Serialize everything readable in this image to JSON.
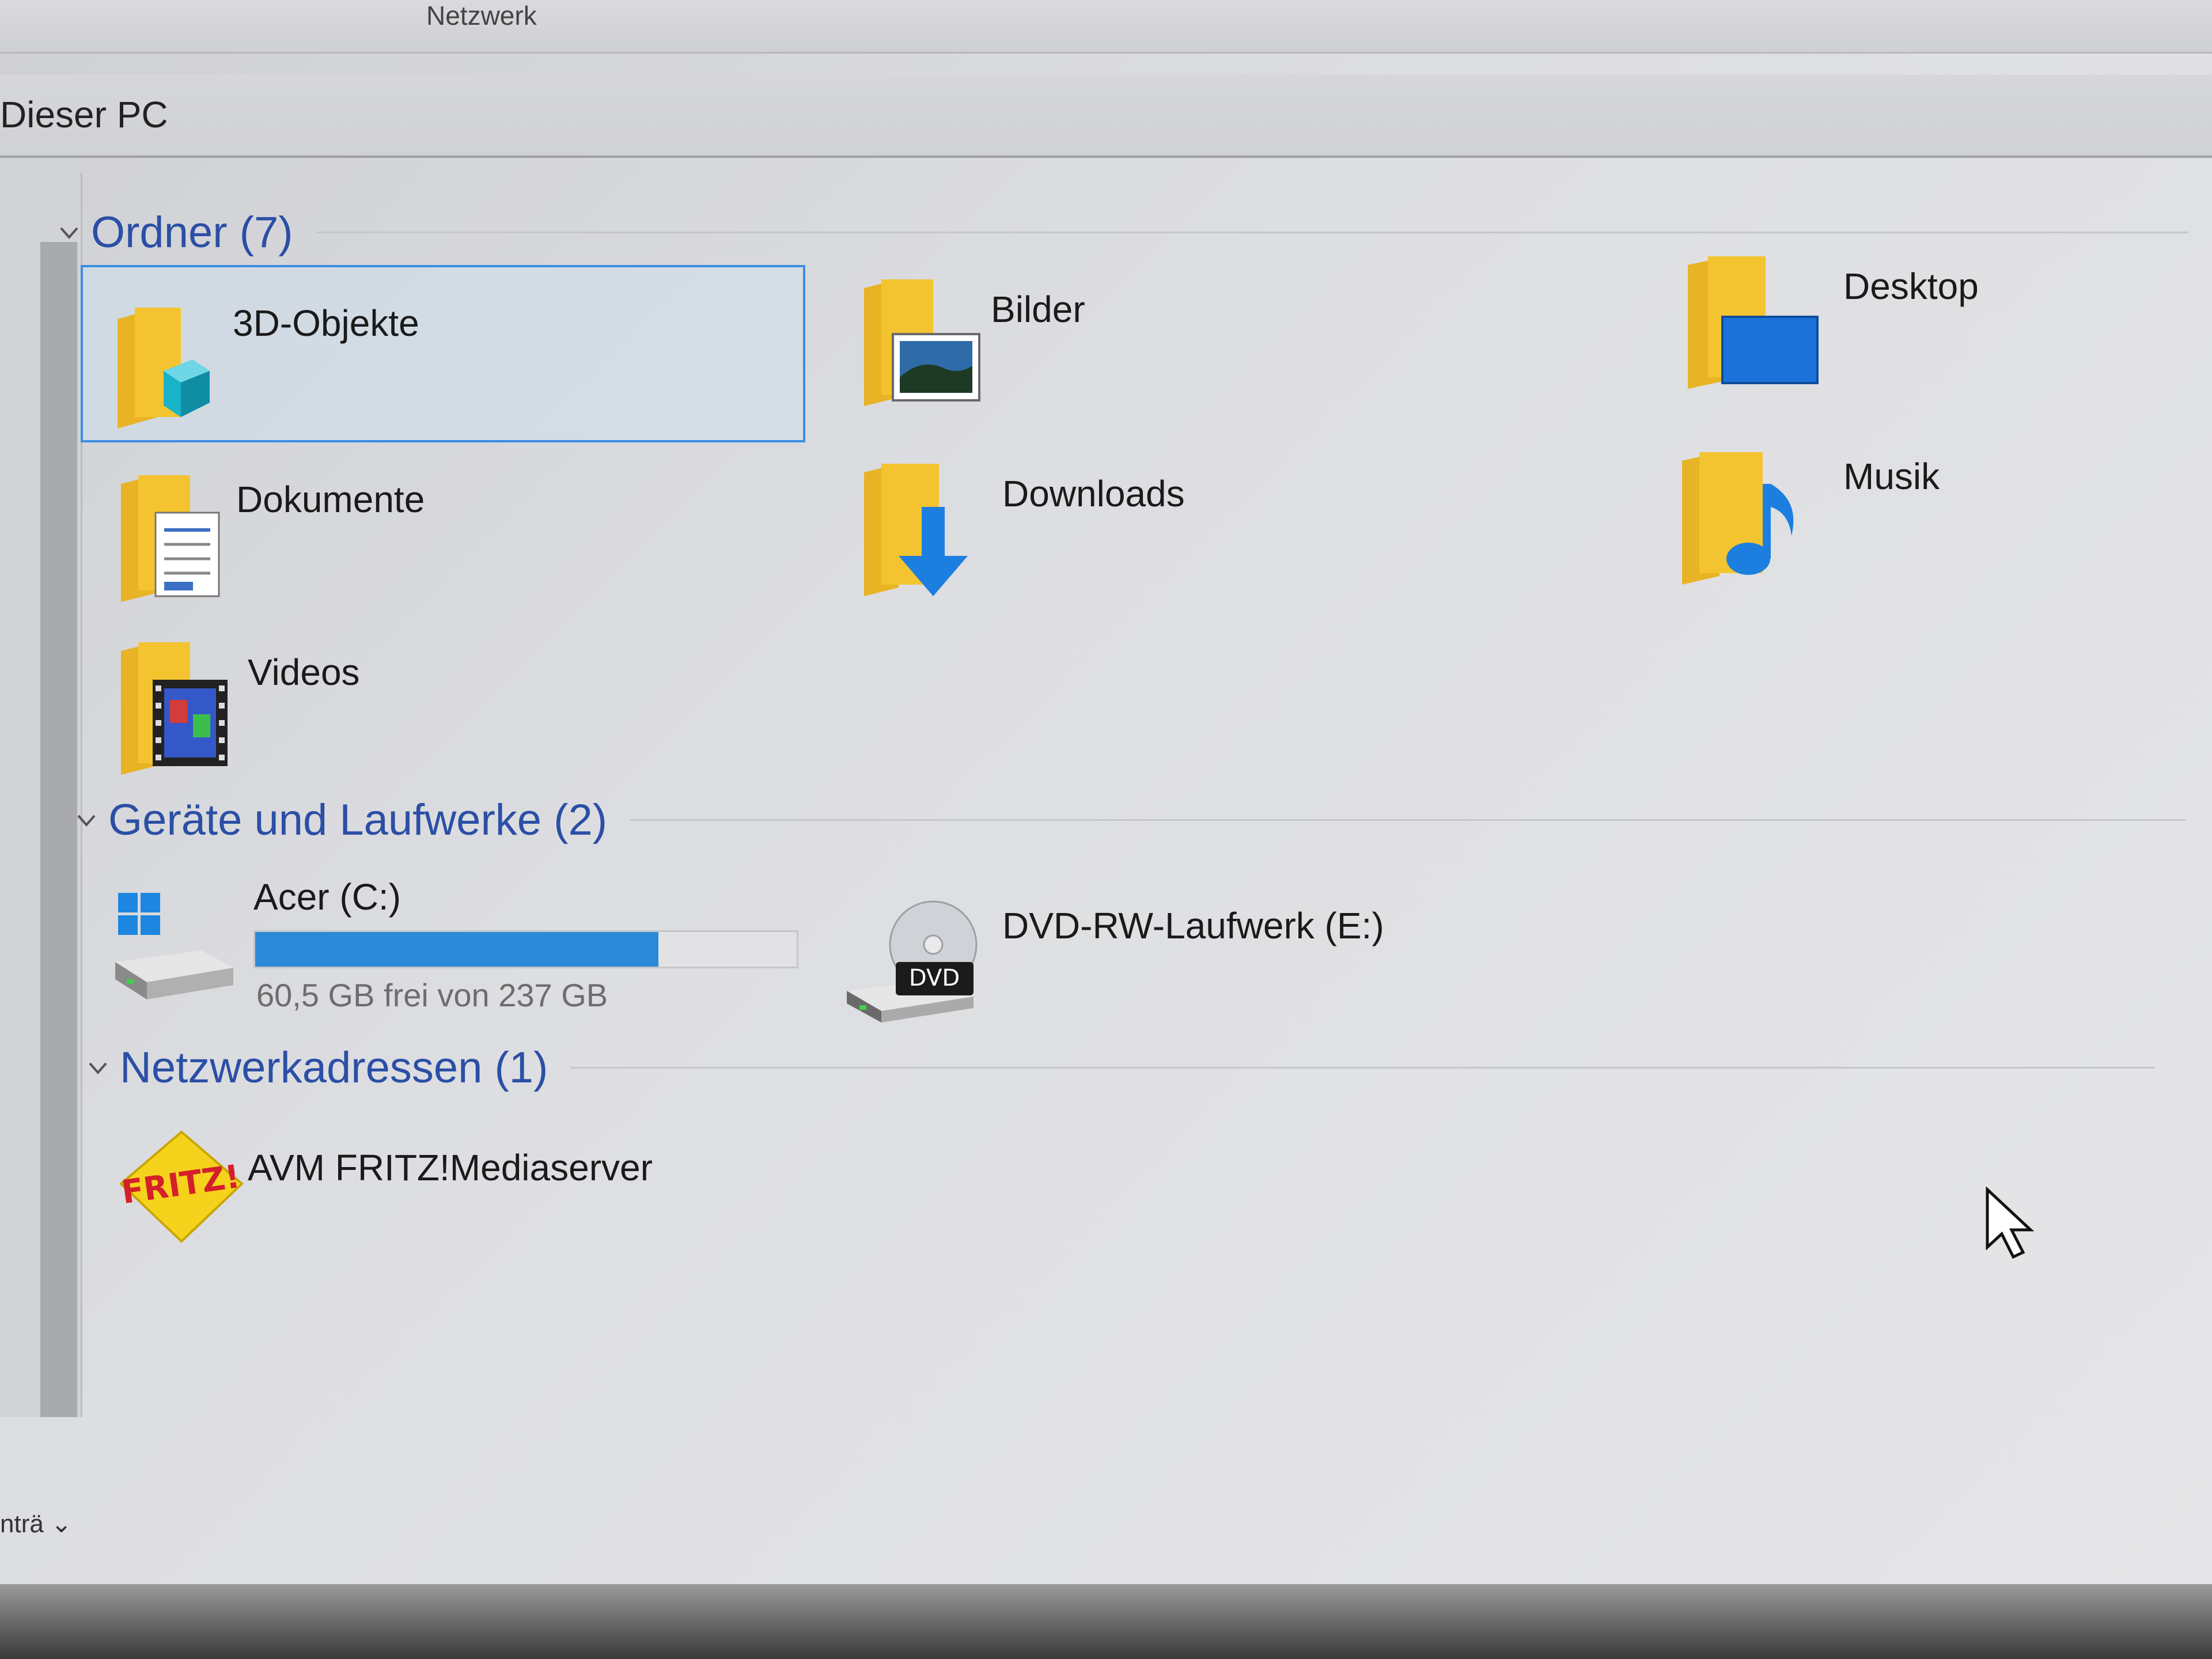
{
  "window": {
    "tab_text": "Netzwerk",
    "address": "Dieser PC",
    "nav_bottom": "nträ"
  },
  "groups": {
    "folders": {
      "title": "Ordner (7)",
      "items": [
        {
          "label": "3D-Objekte",
          "icon": "3d-objects-folder-icon"
        },
        {
          "label": "Bilder",
          "icon": "pictures-folder-icon"
        },
        {
          "label": "Desktop",
          "icon": "desktop-folder-icon"
        },
        {
          "label": "Dokumente",
          "icon": "documents-folder-icon"
        },
        {
          "label": "Downloads",
          "icon": "downloads-folder-icon"
        },
        {
          "label": "Musik",
          "icon": "music-folder-icon"
        },
        {
          "label": "Videos",
          "icon": "videos-folder-icon"
        }
      ]
    },
    "devices": {
      "title": "Geräte und Laufwerke (2)",
      "items": [
        {
          "label": "Acer (C:)",
          "icon": "windows-drive-icon",
          "space": "60,5 GB frei von 237 GB",
          "used_fraction": 0.745
        },
        {
          "label": "DVD-RW-Laufwerk (E:)",
          "icon": "dvd-drive-icon",
          "badge": "DVD"
        }
      ]
    },
    "network": {
      "title": "Netzwerkadressen (1)",
      "items": [
        {
          "label": "AVM FRITZ!Mediaserver",
          "icon": "fritz-media-server-icon",
          "logo_text": "FRITZ!"
        }
      ]
    }
  },
  "colors": {
    "accent": "#2b4fa6",
    "selection": "#3d8de0",
    "drive_fill": "#2a8ad8",
    "folder": "#f4c430"
  }
}
